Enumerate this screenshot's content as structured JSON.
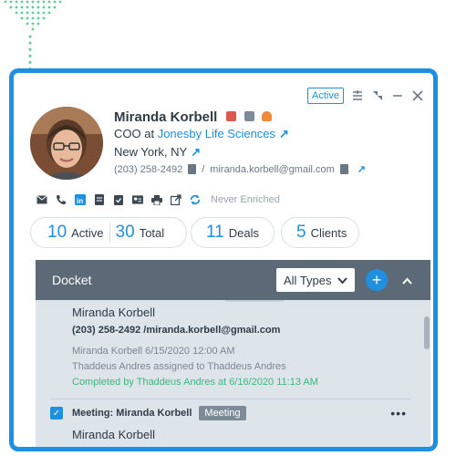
{
  "header": {
    "status_badge": "Active"
  },
  "contact": {
    "name": "Miranda Korbell",
    "title_prefix": "COO at ",
    "company": "Jonesby Life Sciences",
    "location": "New York, NY",
    "phone": "(203) 258-2492",
    "email": "miranda.korbell@gmail.com"
  },
  "enrichment": {
    "status": "Never Enriched"
  },
  "stats": {
    "active_count": "10",
    "active_label": "Active",
    "total_count": "30",
    "total_label": "Total",
    "deals_count": "11",
    "deals_label": "Deals",
    "clients_count": "5",
    "clients_label": "Clients"
  },
  "docket": {
    "title": "Docket",
    "filter_value": "All Types",
    "items": [
      {
        "name": "Miranda Korbell",
        "contact": "(203) 258-2492 /miranda.korbell@gmail.com",
        "meta": "Miranda Korbell   6/15/2020 12:00 AM",
        "assigned": "Thaddeus Andres assigned to Thaddeus Andres",
        "completed": "Completed by  Thaddeus Andres at 6/16/2020 11:13 AM"
      }
    ],
    "meeting": {
      "title": "Meeting: Miranda Korbell",
      "badge": "Meeting",
      "name": "Miranda Korbell"
    }
  },
  "colors": {
    "accent": "#1f8fe0",
    "completed": "#3cb878",
    "docket_header": "#5c6a78"
  }
}
